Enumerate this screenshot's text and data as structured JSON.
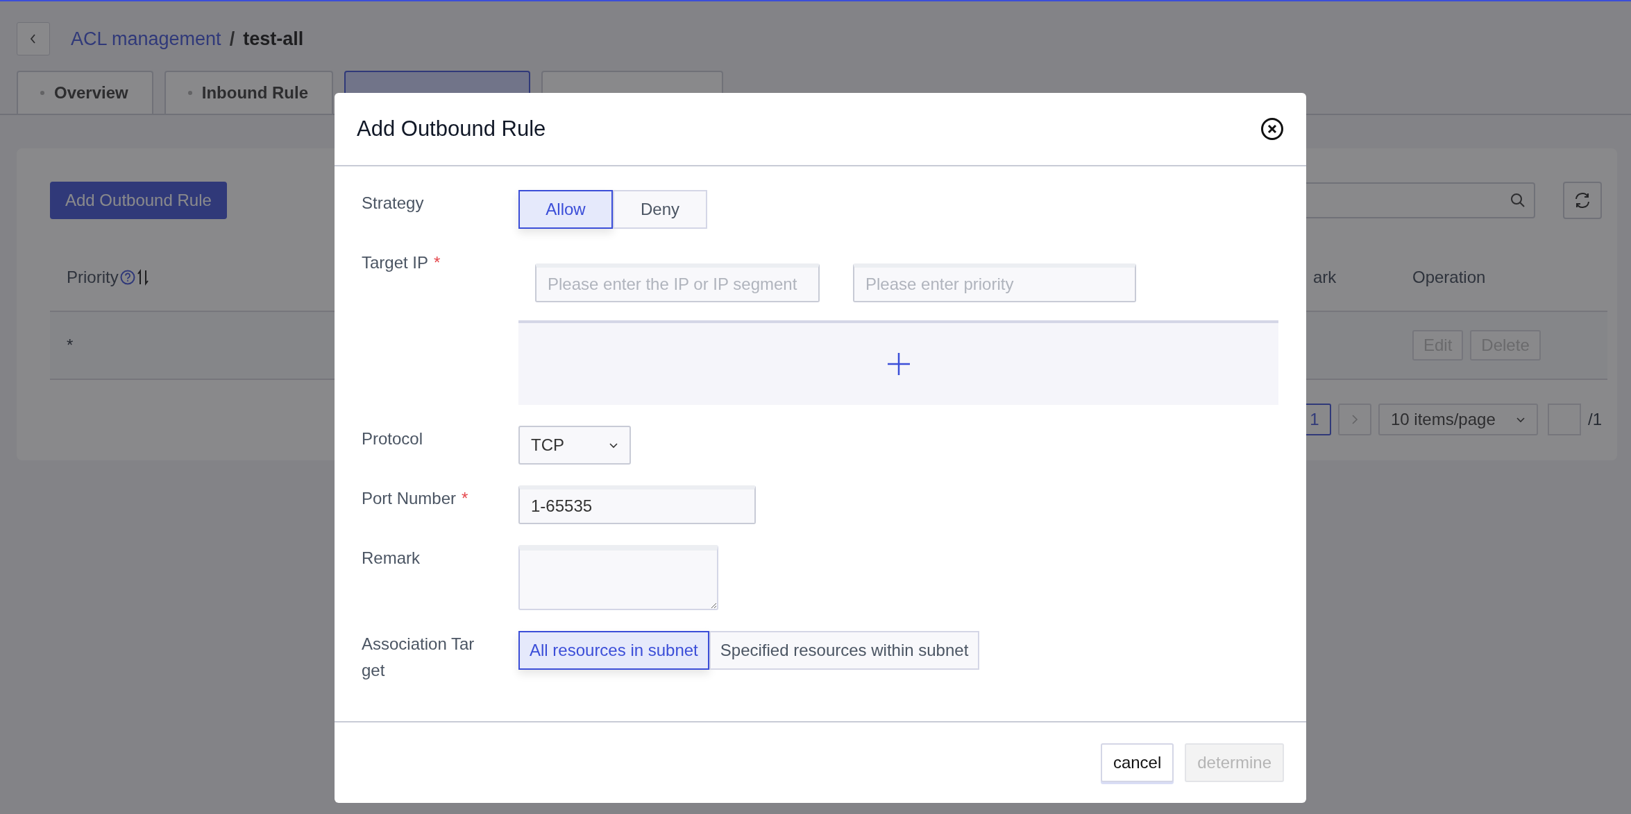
{
  "breadcrumb": {
    "parent": "ACL management",
    "separator": "/",
    "current": "test-all"
  },
  "tabs": [
    {
      "label": "Overview",
      "selected": false
    },
    {
      "label": "Inbound Rule",
      "selected": false
    },
    {
      "selected": true
    },
    {
      "selected": false
    }
  ],
  "toolbar": {
    "add_button": "Add Outbound Rule"
  },
  "table": {
    "columns": [
      "Priority",
      "ark",
      "Operation"
    ],
    "rows": [
      {
        "priority": "*",
        "actions": [
          "Edit",
          "Delete"
        ]
      }
    ]
  },
  "pagination": {
    "pages": [
      {
        "label": "1",
        "selected": true
      }
    ],
    "page_size": "10 items/page",
    "total": "/1"
  },
  "dialog": {
    "title": "Add Outbound Rule",
    "strategy": {
      "label": "Strategy",
      "options": [
        {
          "label": "Allow",
          "selected": true
        },
        {
          "label": "Deny",
          "selected": false
        }
      ]
    },
    "target_ip": {
      "label": "Target IP",
      "required_mark": "*",
      "ip_placeholder": "Please enter the IP or IP segment",
      "priority_placeholder": "Please enter priority"
    },
    "protocol": {
      "label": "Protocol",
      "value": "TCP"
    },
    "port": {
      "label": "Port Number",
      "required_mark": "*",
      "value": "1-65535"
    },
    "remark": {
      "label": "Remark"
    },
    "association": {
      "label": "Association Target",
      "options": [
        {
          "label": "All resources in subnet",
          "selected": true
        },
        {
          "label": "Specified resources within subnet",
          "selected": false
        }
      ]
    },
    "buttons": [
      {
        "label": "cancel",
        "disabled": false
      },
      {
        "label": "determine",
        "disabled": true
      }
    ]
  }
}
